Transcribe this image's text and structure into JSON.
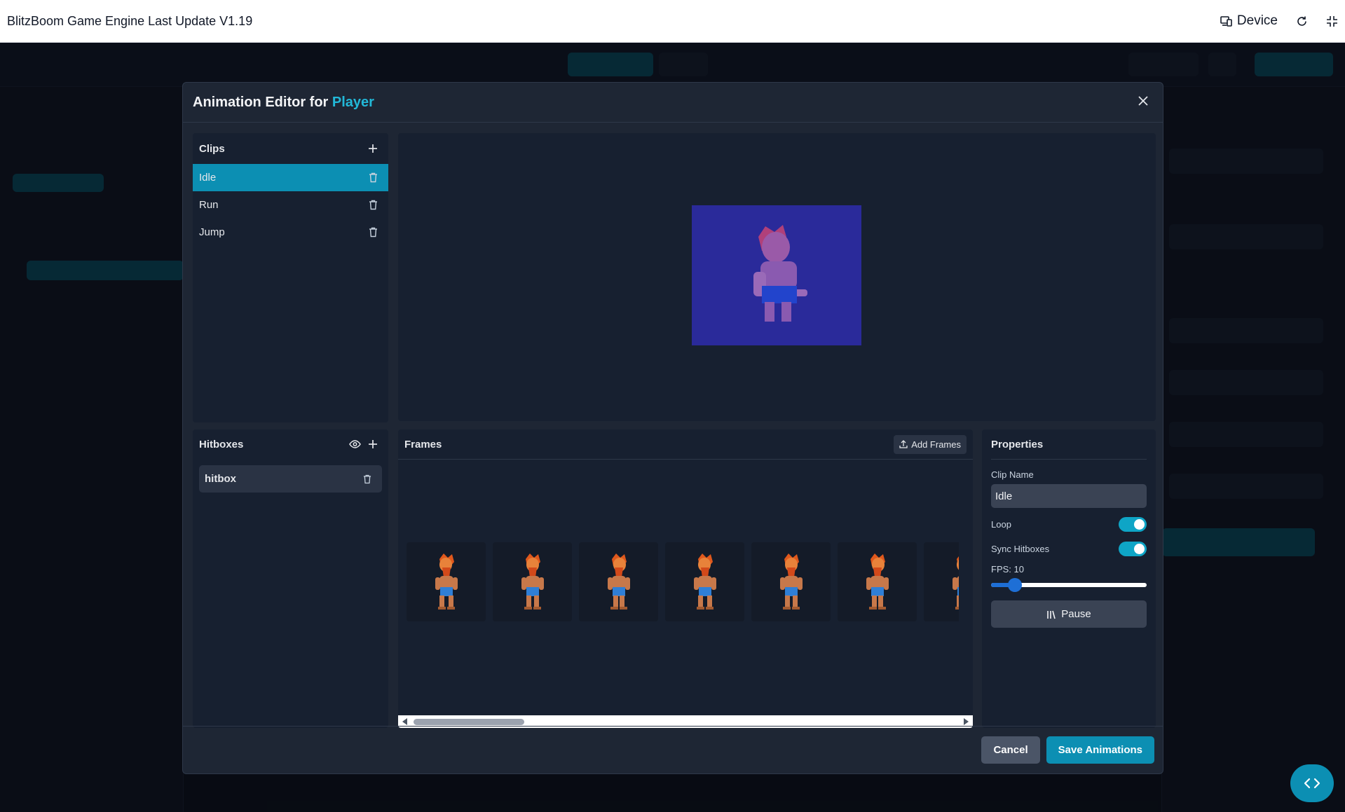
{
  "topbar": {
    "title": "BlitzBoom Game Engine Last Update V1.19",
    "device_label": "Device",
    "icons": [
      "device-icon",
      "refresh-icon",
      "fullscreen-icon"
    ]
  },
  "modal": {
    "title_prefix": "Animation Editor for",
    "title_object": "Player",
    "close_icon": "close-icon"
  },
  "clips": {
    "heading": "Clips",
    "items": [
      {
        "label": "Idle",
        "active": true
      },
      {
        "label": "Run",
        "active": false
      },
      {
        "label": "Jump",
        "active": false
      }
    ]
  },
  "hitboxes": {
    "heading": "Hitboxes",
    "items": [
      {
        "label": "hitbox"
      }
    ]
  },
  "frames": {
    "heading": "Frames",
    "add_label": "Add Frames",
    "visible_frame_count": 7
  },
  "properties": {
    "heading": "Properties",
    "clip_name_label": "Clip Name",
    "clip_name_value": "Idle",
    "loop_label": "Loop",
    "loop_on": true,
    "sync_label": "Sync Hitboxes",
    "sync_on": true,
    "fps_label": "FPS: 10",
    "fps_value": 10,
    "pause_label": "Pause"
  },
  "footer": {
    "cancel_label": "Cancel",
    "save_label": "Save Animations"
  },
  "colors": {
    "accent": "#0c8fb3",
    "accent_text": "#22b8d8",
    "preview_bg": "#2a2a9a"
  },
  "fab_icon": "code-icon"
}
